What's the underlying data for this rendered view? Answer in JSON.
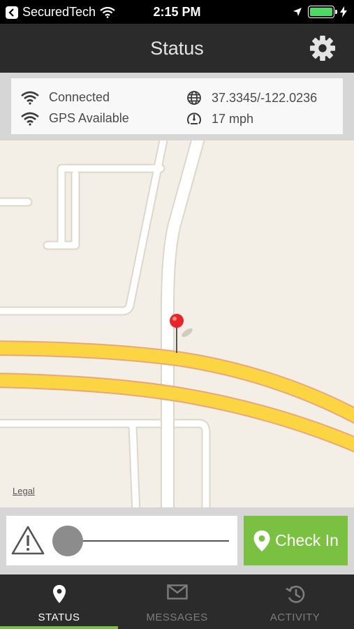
{
  "status_bar": {
    "carrier": "SecuredTech",
    "time": "2:15 PM",
    "battery_level": 1.0,
    "battery_color": "#4cd964"
  },
  "header": {
    "title": "Status",
    "settings_icon": "gear-icon"
  },
  "info": {
    "connection": "Connected",
    "gps": "GPS Available",
    "coordinates": "37.3345/-122.0236",
    "speed": "17 mph"
  },
  "map": {
    "legal": "Legal",
    "pin_color": "#e8262a",
    "highway_color": "#fbd542"
  },
  "controls": {
    "slider_level": 0,
    "check_in_label": "Check In",
    "accent": "#7ac142"
  },
  "tabs": [
    {
      "label": "STATUS",
      "icon": "location-pin-icon",
      "active": true
    },
    {
      "label": "MESSAGES",
      "icon": "envelope-icon",
      "active": false
    },
    {
      "label": "ACTIVITY",
      "icon": "history-icon",
      "active": false
    }
  ]
}
